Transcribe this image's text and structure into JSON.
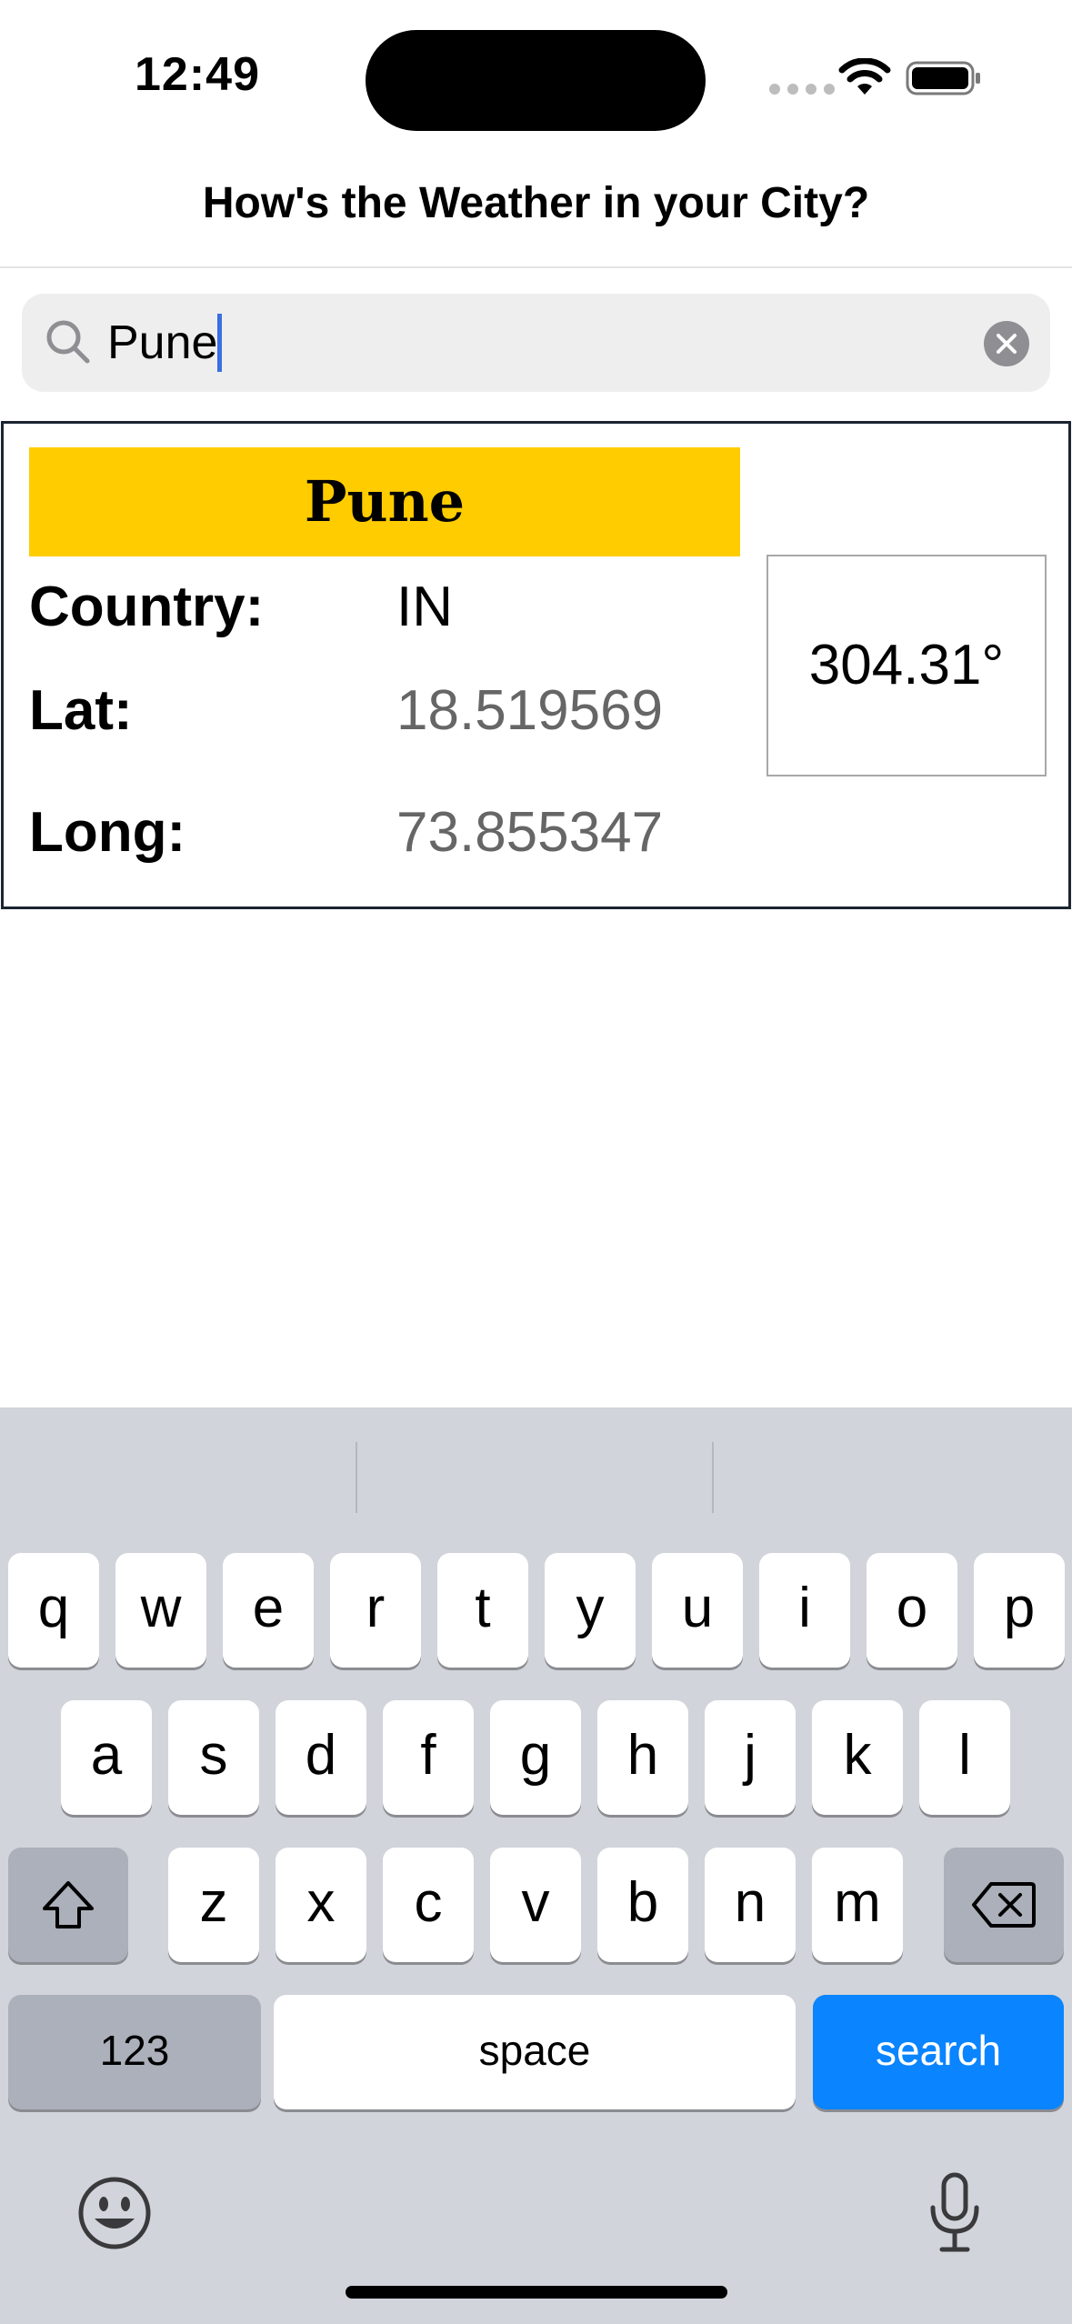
{
  "status_bar": {
    "time": "12:49"
  },
  "nav": {
    "title": "How's the Weather in your City?"
  },
  "search": {
    "value": "Pune"
  },
  "result": {
    "city": "Pune",
    "country_label": "Country:",
    "country_value": "IN",
    "lat_label": "Lat:",
    "lat_value": "18.519569",
    "long_label": "Long:",
    "long_value": "73.855347",
    "temperature": "304.31°"
  },
  "keyboard": {
    "row1": [
      "q",
      "w",
      "e",
      "r",
      "t",
      "y",
      "u",
      "i",
      "o",
      "p"
    ],
    "row2": [
      "a",
      "s",
      "d",
      "f",
      "g",
      "h",
      "j",
      "k",
      "l"
    ],
    "row3": [
      "z",
      "x",
      "c",
      "v",
      "b",
      "n",
      "m"
    ],
    "numbers_label": "123",
    "space_label": "space",
    "return_label": "search",
    "return_color": "#0a84ff"
  },
  "colors": {
    "banner": "#ffcc00",
    "caret": "#3b6fe0"
  }
}
